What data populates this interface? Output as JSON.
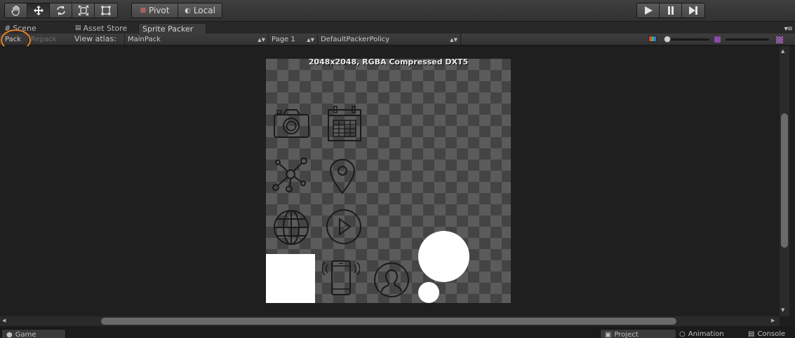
{
  "toolbar": {
    "tools": [
      "hand-icon",
      "move-icon",
      "rotate-icon",
      "scale-icon",
      "rect-icon"
    ],
    "active_tool": "move-icon",
    "pivot_label": "Pivot",
    "local_label": "Local",
    "play_controls": [
      "play-icon",
      "pause-icon",
      "step-icon"
    ]
  },
  "tabs": {
    "scene": "Scene",
    "asset_store": "Asset Store",
    "sprite_packer": "Sprite Packer",
    "active": "Sprite Packer"
  },
  "packer_toolbar": {
    "pack_label": "Pack",
    "repack_label": "Repack",
    "view_atlas_label": "View atlas:",
    "atlas_value": "MainPack",
    "page_value": "Page 1",
    "policy_value": "DefaultPackerPolicy"
  },
  "atlas": {
    "info": "2048x2048, RGBA Compressed DXT5",
    "sprites": [
      "camera-icon",
      "calendar-icon",
      "network-icon",
      "location-pin-icon",
      "globe-icon",
      "play-circle-icon",
      "white-square-sprite",
      "phone-vibrate-icon",
      "user-avatar-icon",
      "white-circle-large-sprite",
      "white-circle-small-sprite"
    ]
  },
  "bottom_tabs": {
    "game": "Game",
    "project": "Project",
    "animation": "Animation",
    "console": "Console"
  },
  "colors": {
    "highlight": "#e67e22"
  }
}
